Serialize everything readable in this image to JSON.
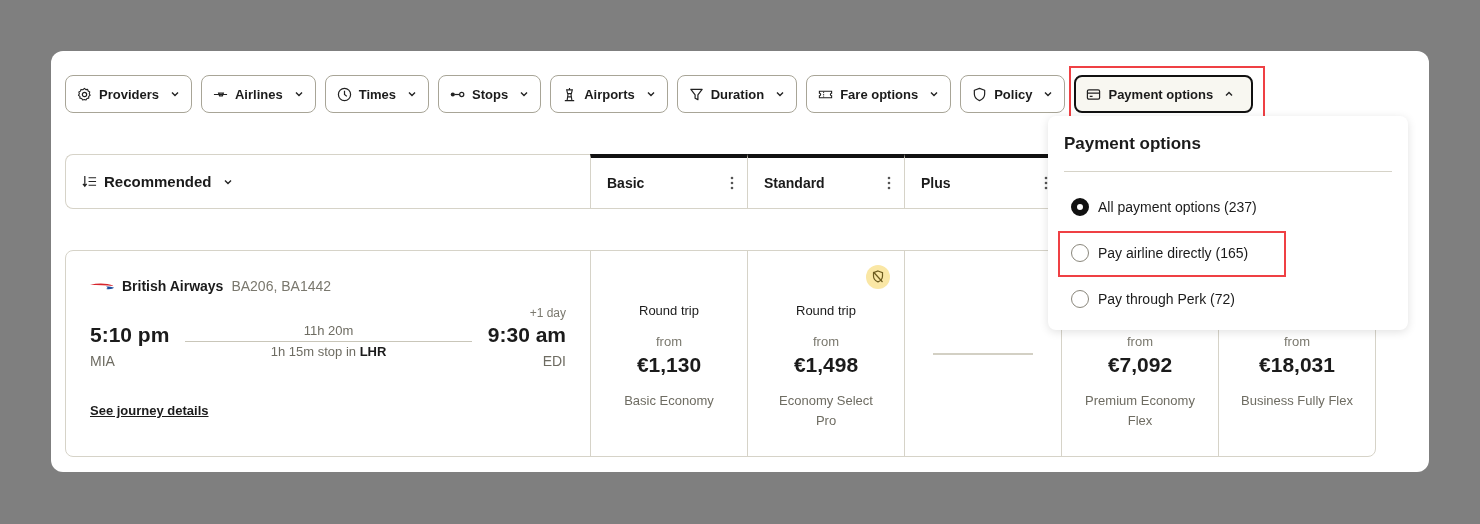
{
  "filters": [
    {
      "label": "Providers",
      "kind": "gear",
      "expanded": false,
      "highlighted": false
    },
    {
      "label": "Airlines",
      "kind": "plane",
      "expanded": false,
      "highlighted": false
    },
    {
      "label": "Times",
      "kind": "clock",
      "expanded": false,
      "highlighted": false
    },
    {
      "label": "Stops",
      "kind": "stops",
      "expanded": false,
      "highlighted": false
    },
    {
      "label": "Airports",
      "kind": "tower",
      "expanded": false,
      "highlighted": false
    },
    {
      "label": "Duration",
      "kind": "filter",
      "expanded": false,
      "highlighted": false
    },
    {
      "label": "Fare options",
      "kind": "ticket",
      "expanded": false,
      "highlighted": false
    },
    {
      "label": "Policy",
      "kind": "shield",
      "expanded": false,
      "highlighted": false
    },
    {
      "label": "Payment options",
      "kind": "card",
      "expanded": true,
      "highlighted": true
    }
  ],
  "sort": {
    "label": "Recommended"
  },
  "fare_columns": [
    {
      "label": "Basic"
    },
    {
      "label": "Standard"
    },
    {
      "label": "Plus"
    }
  ],
  "flight": {
    "airline": "British Airways",
    "flight_numbers": "BA206, BA1442",
    "depart_time": "5:10 pm",
    "depart_airport": "MIA",
    "duration": "11h 20m",
    "stop": "1h 15m stop in **LHR**",
    "day_offset": "+1 day",
    "arrive_time": "9:30 am",
    "arrive_airport": "EDI",
    "details_link": "See journey details"
  },
  "fares": [
    {
      "kind": "fare",
      "trip": "Round trip",
      "from": "from",
      "price": "€1,130",
      "fare_name": "Basic Economy",
      "policy_badge": false
    },
    {
      "kind": "fare",
      "trip": "Round trip",
      "from": "from",
      "price": "€1,498",
      "fare_name": "Economy Select Pro",
      "policy_badge": true
    },
    {
      "kind": "unavailable"
    },
    {
      "kind": "fare",
      "from": "from",
      "price": "€7,092",
      "fare_name": "Premium Economy Flex"
    },
    {
      "kind": "fare",
      "from": "from",
      "price": "€18,031",
      "fare_name": "Business Fully Flex"
    }
  ],
  "dropdown": {
    "title": "Payment options",
    "options": [
      {
        "label": "All payment options (237)",
        "selected": true,
        "highlighted": false
      },
      {
        "label": "Pay airline directly (165)",
        "selected": false,
        "highlighted": true
      },
      {
        "label": "Pay through Perk (72)",
        "selected": false,
        "highlighted": false
      }
    ]
  }
}
